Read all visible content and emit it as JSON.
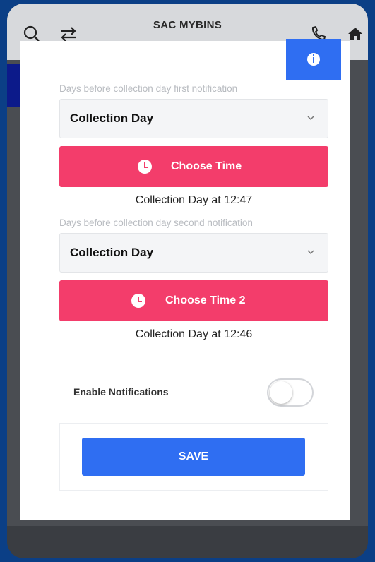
{
  "appbar": {
    "title": "SAC MYBINS",
    "icons": [
      "search-icon",
      "swap-icon",
      "phone-icon",
      "home-icon"
    ]
  },
  "modal": {
    "info_icon": "info-icon",
    "first": {
      "hint": "Days before collection day first notification",
      "select_value": "Collection Day",
      "button_label": "Choose Time",
      "summary": "Collection Day at 12:47"
    },
    "second": {
      "hint": "Days before collection day second notification",
      "select_value": "Collection Day",
      "button_label": "Choose Time 2",
      "summary": "Collection Day at 12:46"
    },
    "notifications": {
      "label": "Enable Notifications",
      "enabled": false
    },
    "save_label": "SAVE"
  },
  "colors": {
    "accent_pink": "#f33d6b",
    "accent_blue": "#2f6ef2",
    "backdrop": "#0b3f86"
  }
}
